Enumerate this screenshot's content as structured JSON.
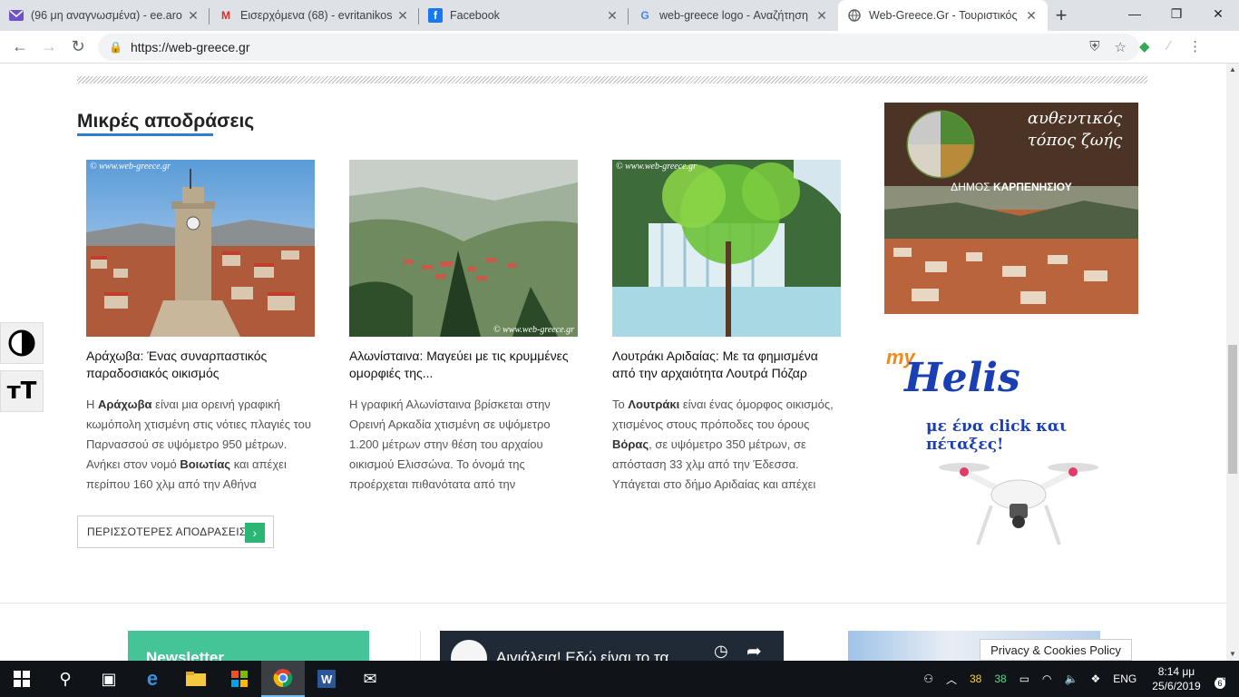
{
  "browser": {
    "tabs": [
      {
        "title": "(96 μη αναγνωσμένα) - ee.aro",
        "icon": "mail-icon",
        "color": "#6f52c7"
      },
      {
        "title": "Εισερχόμενα (68) - evritanikos",
        "icon": "gmail-icon",
        "color": "#d93025"
      },
      {
        "title": "Facebook",
        "icon": "facebook-icon",
        "color": "#1877f2"
      },
      {
        "title": "web-greece logo - Αναζήτηση",
        "icon": "google-icon",
        "color": "#4285f4"
      },
      {
        "title": "Web-Greece.Gr - Τουριστικός",
        "icon": "globe-icon",
        "color": "#5f6368"
      }
    ],
    "url": "https://web-greece.gr"
  },
  "section": {
    "title": "Μικρές αποδράσεις"
  },
  "cards": [
    {
      "watermark": "© www.web-greece.gr",
      "title": "Αράχωβα: Ένας συναρπαστικός παραδοσιακός οικισμός",
      "p1": "Η ",
      "b1": "Αράχωβα",
      "p2": " είναι μια ορεινή γραφική κωμόπολη χτισμένη στις νότιες πλαγιές του Παρνασσού σε υψόμετρο 950 μέτρων. Ανήκει στον νομό ",
      "b2": "Βοιωτίας",
      "p3": " και απέχει περίπου 160 χλμ από την Αθήνα"
    },
    {
      "watermark": "© www.web-greece.gr",
      "title": "Αλωνίσταινα: Μαγεύει με τις κρυμμένες ομορφιές της...",
      "p1": "Η γραφική Αλωνίσταινα βρίσκεται στην Ορεινή Αρκαδία χτισμένη σε υψόμετρο 1.200 μέτρων στην θέση του αρχαίου οικισμού Ελισσώνα. Το όνομά της προέρχεται πιθανότατα από την",
      "b1": "",
      "p2": "",
      "b2": "",
      "p3": ""
    },
    {
      "watermark": "© www.web-greece.gr",
      "title": "Λουτράκι Αριδαίας: Με τα φημισμένα από την αρχαιότητα Λουτρά Πόζαρ",
      "p1": "Το ",
      "b1": "Λουτράκι",
      "p2": " είναι ένας όμορφος οικισμός, χτισμένος στους πρόποδες του όρους ",
      "b2": "Βόρας",
      "p3": ", σε υψόμετρο 350 μέτρων, σε απόσταση 33 χλμ από την Έδεσσα. Υπάγεται στο δήμο Αριδαίας και απέχει"
    }
  ],
  "more_button": {
    "label": "ΠΕΡΙΣΣΟΤΕΡΕΣ ΑΠΟΔΡΑΣΕΙΣ",
    "accent": "#2bb673"
  },
  "ads": {
    "karpenisi": {
      "slogan_1": "αυθεντικός",
      "slogan_2": "τόπος ζωής",
      "municipality_prefix": "ΔΗΜΟΣ ",
      "municipality_name": "ΚΑΡΠΕΝΗΣΙΟΥ"
    },
    "helis": {
      "brand_my": "my",
      "brand_name": "Helis",
      "tagline": "με ένα click και πέταξες!"
    }
  },
  "footer_preview": {
    "newsletter": "Newsletter",
    "video_title": "Αιγιάλεια! Εδώ είναι το τα",
    "cookie_policy": "Privacy & Cookies Policy"
  },
  "a11y": {
    "contrast_icon": "contrast-icon",
    "textsize_label": "тT"
  },
  "taskbar": {
    "tray_temp_1": "38",
    "tray_temp_2": "38",
    "lang": "ENG",
    "time": "8:14 μμ",
    "date": "25/6/2019",
    "notifications": "6"
  },
  "colors": {
    "accent_blue": "#2a7fd4",
    "accent_green": "#2bb673",
    "newsletter_green": "#44c497"
  }
}
